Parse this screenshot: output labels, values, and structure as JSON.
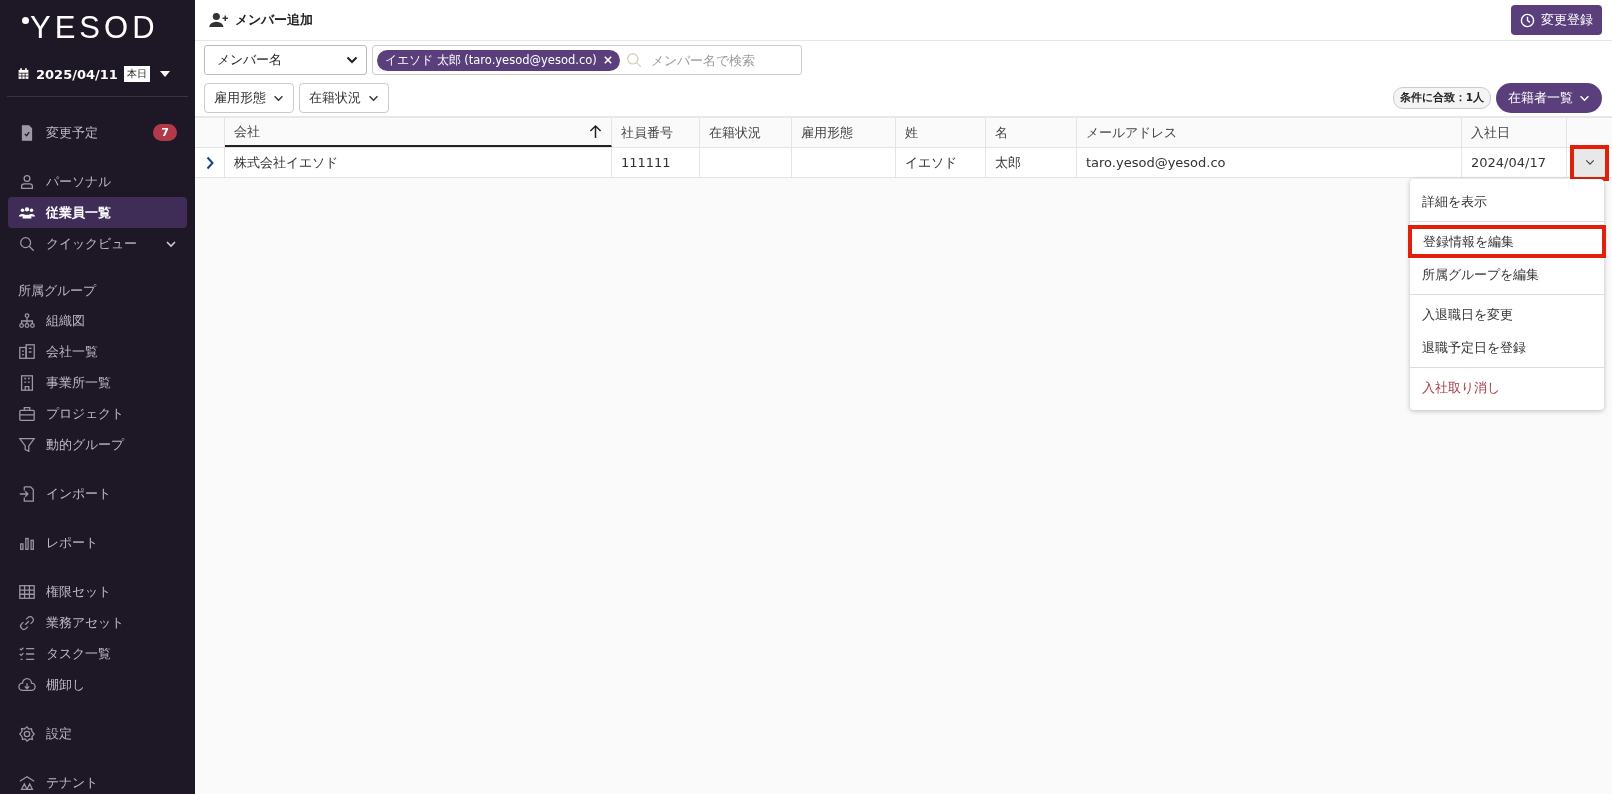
{
  "sidebar": {
    "logo": "YESOD",
    "date": "2025/04/11",
    "today_badge": "本日",
    "sections": [
      {
        "items": [
          {
            "label": "変更予定",
            "badge": "7",
            "selected": false
          }
        ]
      },
      {
        "items": [
          {
            "label": "パーソナル",
            "selected": false
          },
          {
            "label": "従業員一覧",
            "selected": true
          },
          {
            "label": "クイックビュー",
            "selected": false,
            "expandable": true
          }
        ]
      },
      {
        "heading": "所属グループ",
        "items": [
          {
            "label": "組織図",
            "selected": false
          },
          {
            "label": "会社一覧",
            "selected": false
          },
          {
            "label": "事業所一覧",
            "selected": false
          },
          {
            "label": "プロジェクト",
            "selected": false
          },
          {
            "label": "動的グループ",
            "selected": false
          }
        ]
      },
      {
        "items": [
          {
            "label": "インポート",
            "selected": false
          }
        ]
      },
      {
        "items": [
          {
            "label": "レポート",
            "selected": false
          }
        ]
      },
      {
        "items": [
          {
            "label": "権限セット",
            "selected": false
          },
          {
            "label": "業務アセット",
            "selected": false
          },
          {
            "label": "タスク一覧",
            "selected": false
          },
          {
            "label": "棚卸し",
            "selected": false
          }
        ]
      },
      {
        "items": [
          {
            "label": "設定",
            "selected": false
          }
        ]
      },
      {
        "items": [
          {
            "label": "テナント",
            "selected": false
          }
        ]
      }
    ]
  },
  "header": {
    "add_member": "メンバー追加",
    "change_button": "変更登録"
  },
  "filters": {
    "field_select": "メンバー名",
    "chip": "イエソド 太郎 (taro.yesod@yesod.co)",
    "search_placeholder": "メンバー名で検索",
    "dropdowns": [
      "雇用形態",
      "在籍状況"
    ],
    "match_count": "条件に合致：1人",
    "list_button": "在籍者一覧"
  },
  "table": {
    "columns": [
      "会社",
      "社員番号",
      "在籍状況",
      "雇用形態",
      "姓",
      "名",
      "メールアドレス",
      "入社日"
    ],
    "rows": [
      {
        "cells": [
          "株式会社イエソド",
          "111111",
          "",
          "",
          "イエソド",
          "太郎",
          "taro.yesod@yesod.co",
          "2024/04/17"
        ],
        "highlighted": true
      }
    ]
  },
  "menu": {
    "groups": [
      [
        {
          "label": "詳細を表示",
          "kind": "normal",
          "highlighted": false
        }
      ],
      [
        {
          "label": "登録情報を編集",
          "kind": "normal",
          "highlighted": true
        },
        {
          "label": "所属グループを編集",
          "kind": "normal",
          "highlighted": false
        }
      ],
      [
        {
          "label": "入退職日を変更",
          "kind": "normal",
          "highlighted": false
        },
        {
          "label": "退職予定日を登録",
          "kind": "normal",
          "highlighted": false
        }
      ],
      [
        {
          "label": "入社取り消し",
          "kind": "danger",
          "highlighted": false
        }
      ]
    ]
  }
}
